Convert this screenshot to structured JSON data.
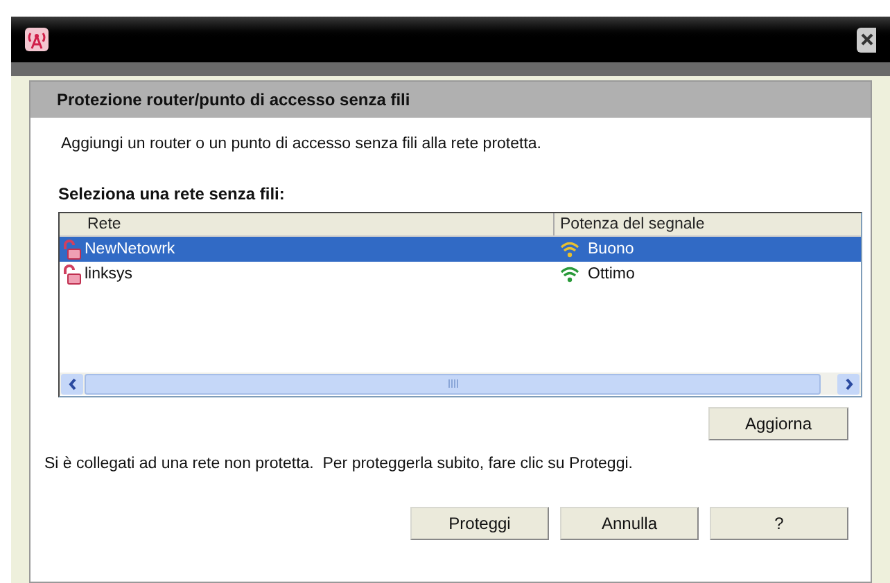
{
  "panel": {
    "title": "Protezione router/punto di accesso senza fili",
    "intro": "Aggiungi un router o un punto di accesso senza fili alla rete protetta."
  },
  "list": {
    "label": "Seleziona una rete senza fili:",
    "columns": [
      "Rete",
      "Potenza del segnale"
    ],
    "rows": [
      {
        "name": "NewNetowrk",
        "signal": "Buono",
        "color": "#e8c030",
        "selected": true
      },
      {
        "name": "linksys",
        "signal": "Ottimo",
        "color": "#2a9a3a",
        "selected": false
      }
    ]
  },
  "refresh_button": "Aggiorna",
  "message": "Si è collegati ad una rete non protetta.  Per proteggerla subito, fare clic su Proteggi.",
  "buttons": [
    "Proteggi",
    "Annulla",
    "?"
  ]
}
